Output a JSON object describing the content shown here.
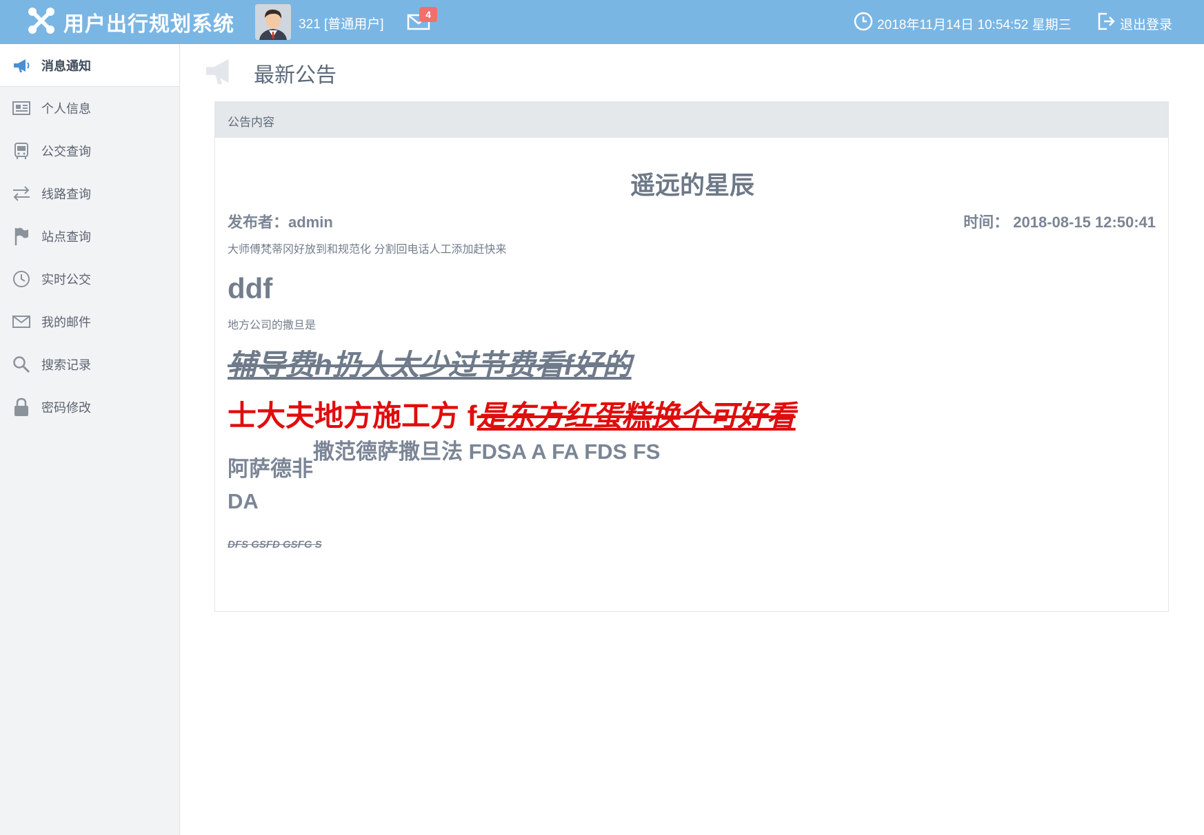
{
  "app": {
    "title": "用户出行规划系统",
    "user_label": "321 [普通用户]",
    "mail_count": "4",
    "datetime": "2018年11月14日 10:54:52 星期三",
    "logout_label": "退出登录"
  },
  "sidebar": {
    "items": [
      {
        "label": "消息通知",
        "icon": "megaphone-icon",
        "active": true
      },
      {
        "label": "个人信息",
        "icon": "id-card-icon"
      },
      {
        "label": "公交查询",
        "icon": "bus-icon"
      },
      {
        "label": "线路查询",
        "icon": "exchange-icon"
      },
      {
        "label": "站点查询",
        "icon": "flag-icon"
      },
      {
        "label": "实时公交",
        "icon": "clock-icon"
      },
      {
        "label": "我的邮件",
        "icon": "mail-icon"
      },
      {
        "label": "搜索记录",
        "icon": "search-icon"
      },
      {
        "label": "密码修改",
        "icon": "lock-icon"
      }
    ]
  },
  "main": {
    "page_title": "最新公告",
    "panel_title": "公告内容",
    "post": {
      "title": "遥远的星辰",
      "author": "发布者：admin",
      "time": "时间：  2018-08-15 12:50:41",
      "paragraph1": "大师傅梵蒂冈好放到和规范化 分割回电话人工添加赶快来",
      "heading_ddf": "ddf",
      "paragraph2": "地方公司的撒旦是",
      "strike_text": "辅导费h扔人太少过节费看f好的",
      "red_plain": "士大夫地方施工方 f",
      "red_em": "是东方红蛋糕换个可好看",
      "mixed_a": "阿萨德非",
      "mixed_b": "撒范德萨撒旦法 FDSA A FA FDS FS",
      "mixed_c": "DA",
      "small_strike": "DFS GSFD GSFG S"
    }
  },
  "colors": {
    "header_bg": "#7ab6e4",
    "sidebar_bg": "#f2f3f5",
    "badge": "#f26f6f",
    "accent_red": "#e00d0d"
  }
}
